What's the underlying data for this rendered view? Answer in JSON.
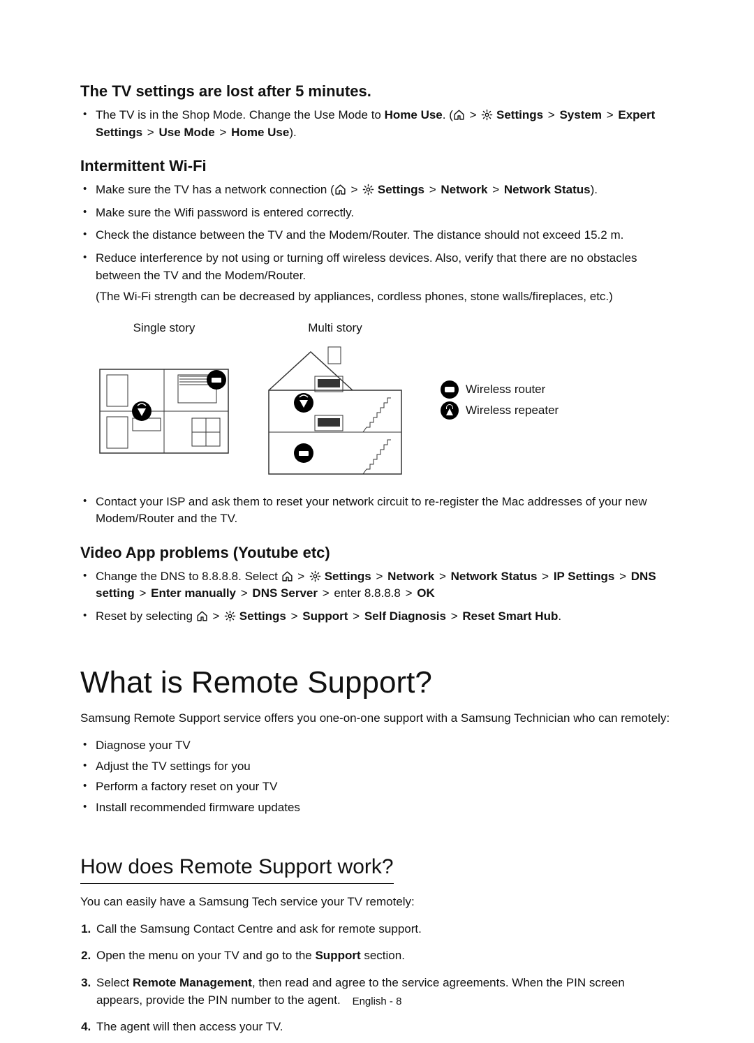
{
  "tv_lost": {
    "heading": "The TV settings are lost after 5 minutes.",
    "bullet": {
      "pre": "The TV is in the Shop Mode. Change the Use Mode to ",
      "home_use": "Home Use",
      "open": ". (",
      "path": [
        "Settings",
        "System",
        "Expert Settings",
        "Use Mode",
        "Home Use"
      ],
      "close": ")."
    }
  },
  "wifi": {
    "heading": "Intermittent Wi-Fi",
    "b1_pre": "Make sure the TV has a network connection (",
    "b1_path": [
      "Settings",
      "Network",
      "Network Status"
    ],
    "b1_post": ").",
    "b2": "Make sure the Wifi password is entered correctly.",
    "b3": "Check the distance between the TV and the Modem/Router. The distance should not exceed 15.2 m.",
    "b4a": "Reduce interference by not using or turning off wireless devices. Also, verify that there are no obstacles between the TV and the Modem/Router.",
    "b4b": "(The Wi-Fi strength can be decreased by appliances, cordless phones, stone walls/fireplaces, etc.)",
    "diag_single": "Single story",
    "diag_multi": "Multi story",
    "legend_router": "Wireless router",
    "legend_repeater": "Wireless repeater",
    "b5": "Contact your ISP and ask them to reset your network circuit to re-register the Mac addresses of your new Modem/Router and the TV."
  },
  "video": {
    "heading": "Video App problems (Youtube etc)",
    "b1_pre": "Change the DNS to 8.8.8.8. Select ",
    "b1_path": [
      "Settings",
      "Network",
      "Network Status",
      "IP Settings",
      "DNS setting",
      "Enter manually",
      "DNS Server"
    ],
    "b1_mid": " enter 8.8.8.8 ",
    "b1_ok": "OK",
    "b2_pre": "Reset by selecting ",
    "b2_path": [
      "Settings",
      "Support",
      "Self Diagnosis",
      "Reset Smart Hub"
    ],
    "b2_post": "."
  },
  "remote": {
    "heading": "What is Remote Support?",
    "intro": "Samsung Remote Support service offers you one-on-one support with a Samsung Technician who can remotely:",
    "items": [
      "Diagnose your TV",
      "Adjust the TV settings for you",
      "Perform a factory reset on your TV",
      "Install recommended firmware updates"
    ]
  },
  "how": {
    "heading": "How does Remote Support work?",
    "intro": "You can easily have a Samsung Tech service your TV remotely:",
    "step1": "Call the Samsung Contact Centre and ask for remote support.",
    "step2_pre": "Open the menu on your TV and go to the ",
    "step2_b": "Support",
    "step2_post": " section.",
    "step3_pre": "Select ",
    "step3_b": "Remote Management",
    "step3_post": ", then read and agree to the service agreements. When the PIN screen appears, provide the PIN number to the agent.",
    "step4": "The agent will then access your TV."
  },
  "footer": "English - 8",
  "sep": ">"
}
